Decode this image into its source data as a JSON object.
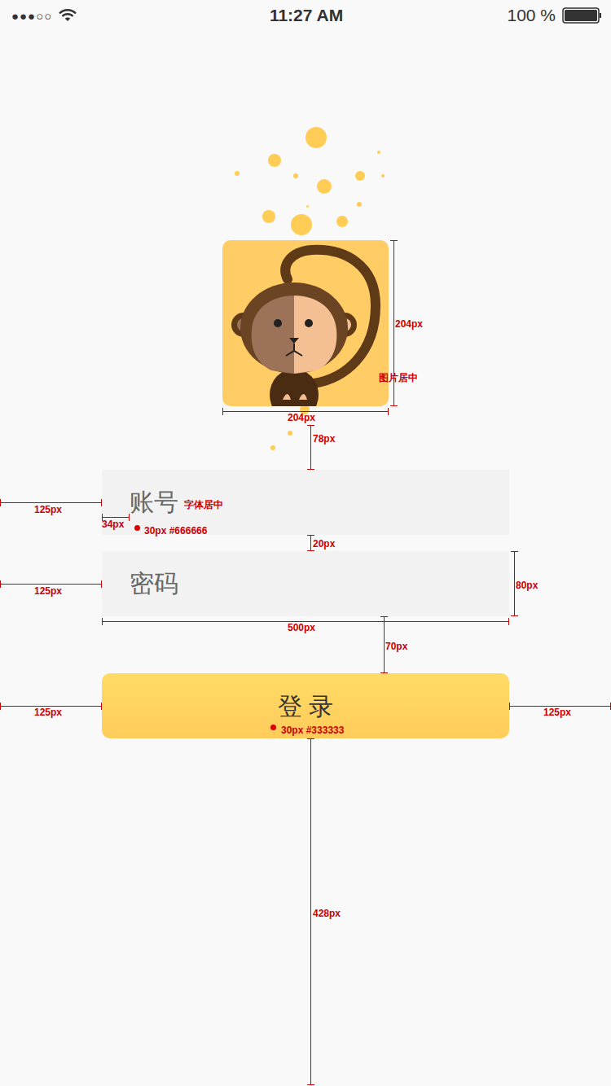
{
  "status_bar": {
    "signal": "●●●○○",
    "time": "11:27 AM",
    "battery": "100 %",
    "battery_level": 1
  },
  "form": {
    "account_placeholder": "账号",
    "password_placeholder": "密码",
    "login_button": "登 录"
  },
  "annotations": [
    {
      "text": "204px"
    },
    {
      "text": "图片居中"
    },
    {
      "text": "204px"
    },
    {
      "text": "78px"
    },
    {
      "text": "125px"
    },
    {
      "text": "字体居中"
    },
    {
      "text": "34px"
    },
    {
      "text": "30px #666666"
    },
    {
      "text": "20px"
    },
    {
      "text": "125px"
    },
    {
      "text": "80px"
    },
    {
      "text": "500px"
    },
    {
      "text": "70px"
    },
    {
      "text": "125px"
    },
    {
      "text": "125px"
    },
    {
      "text": "30px #333333"
    },
    {
      "text": "428px"
    }
  ]
}
